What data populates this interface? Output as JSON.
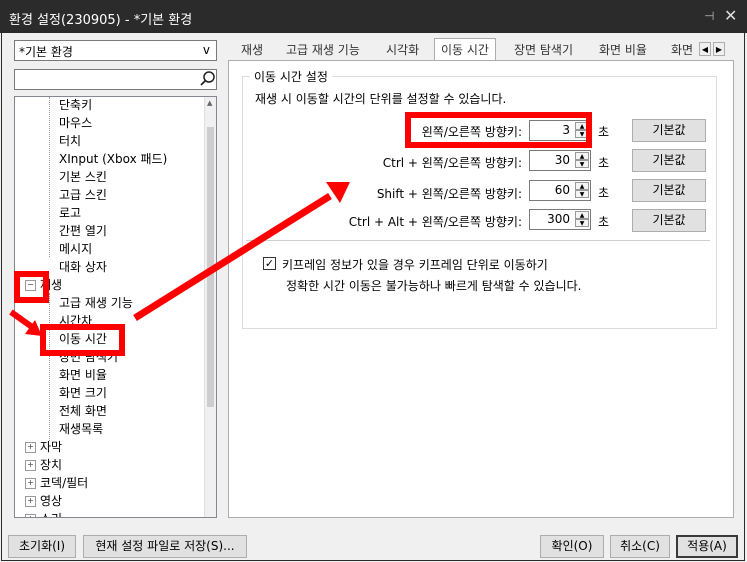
{
  "window": {
    "title": "환경 설정(230905) - *기본 환경",
    "pin_glyph": "⊣",
    "close_glyph": "✕"
  },
  "sidebar": {
    "preset_value": "*기본 환경",
    "preset_chevron": "v",
    "search_value": "",
    "tree": {
      "children_top": [
        "단축키",
        "마우스",
        "터치",
        "XInput (Xbox 패드)",
        "기본 스킨",
        "고급 스킨",
        "로고",
        "간편 열기",
        "메시지",
        "대화 상자"
      ],
      "playback_group": "재생",
      "playback_children": [
        "고급 재생 기능",
        "시간차",
        "이동 시간",
        "장면 탐색기",
        "화면 비율",
        "화면 크기",
        "전체 화면",
        "재생목록"
      ],
      "other_groups": [
        "자막",
        "장치",
        "코덱/필터",
        "영상",
        "소리"
      ]
    }
  },
  "tabs": [
    "재생",
    "고급 재생 기능",
    "시각화",
    "이동 시간",
    "장면 탐색기",
    "화면 비율",
    "화면"
  ],
  "active_tab": 3,
  "tab_scroll_left": "◀",
  "tab_scroll_right": "▶",
  "section": {
    "title": "이동 시간 설정",
    "description": "재생 시 이동할 시간의 단위를 설정할 수 있습니다.",
    "rows": [
      {
        "label": "왼쪽/오른쪽 방향키:",
        "value": "3",
        "unit": "초",
        "reset": "기본값"
      },
      {
        "label": "Ctrl + 왼쪽/오른쪽 방향키:",
        "value": "30",
        "unit": "초",
        "reset": "기본값"
      },
      {
        "label": "Shift + 왼쪽/오른쪽 방향키:",
        "value": "60",
        "unit": "초",
        "reset": "기본값"
      },
      {
        "label": "Ctrl + Alt + 왼쪽/오른쪽 방향키:",
        "value": "300",
        "unit": "초",
        "reset": "기본값"
      }
    ],
    "keyframe_checkbox": {
      "checked": true,
      "mark": "✓",
      "label": "키프레임 정보가 있을 경우 키프레임 단위로 이동하기",
      "note": "정확한 시간 이동은 불가능하나 빠르게 탐색할 수 있습니다."
    }
  },
  "footer": {
    "reset_button": "초기화(I)",
    "save_as_button": "현재 설정 파일로 저장(S)...",
    "ok_button": "확인(O)",
    "cancel_button": "취소(C)",
    "apply_button": "적용(A)"
  },
  "colors": {
    "highlight": "#ff0000",
    "titlebar": "#2b2b2b"
  }
}
